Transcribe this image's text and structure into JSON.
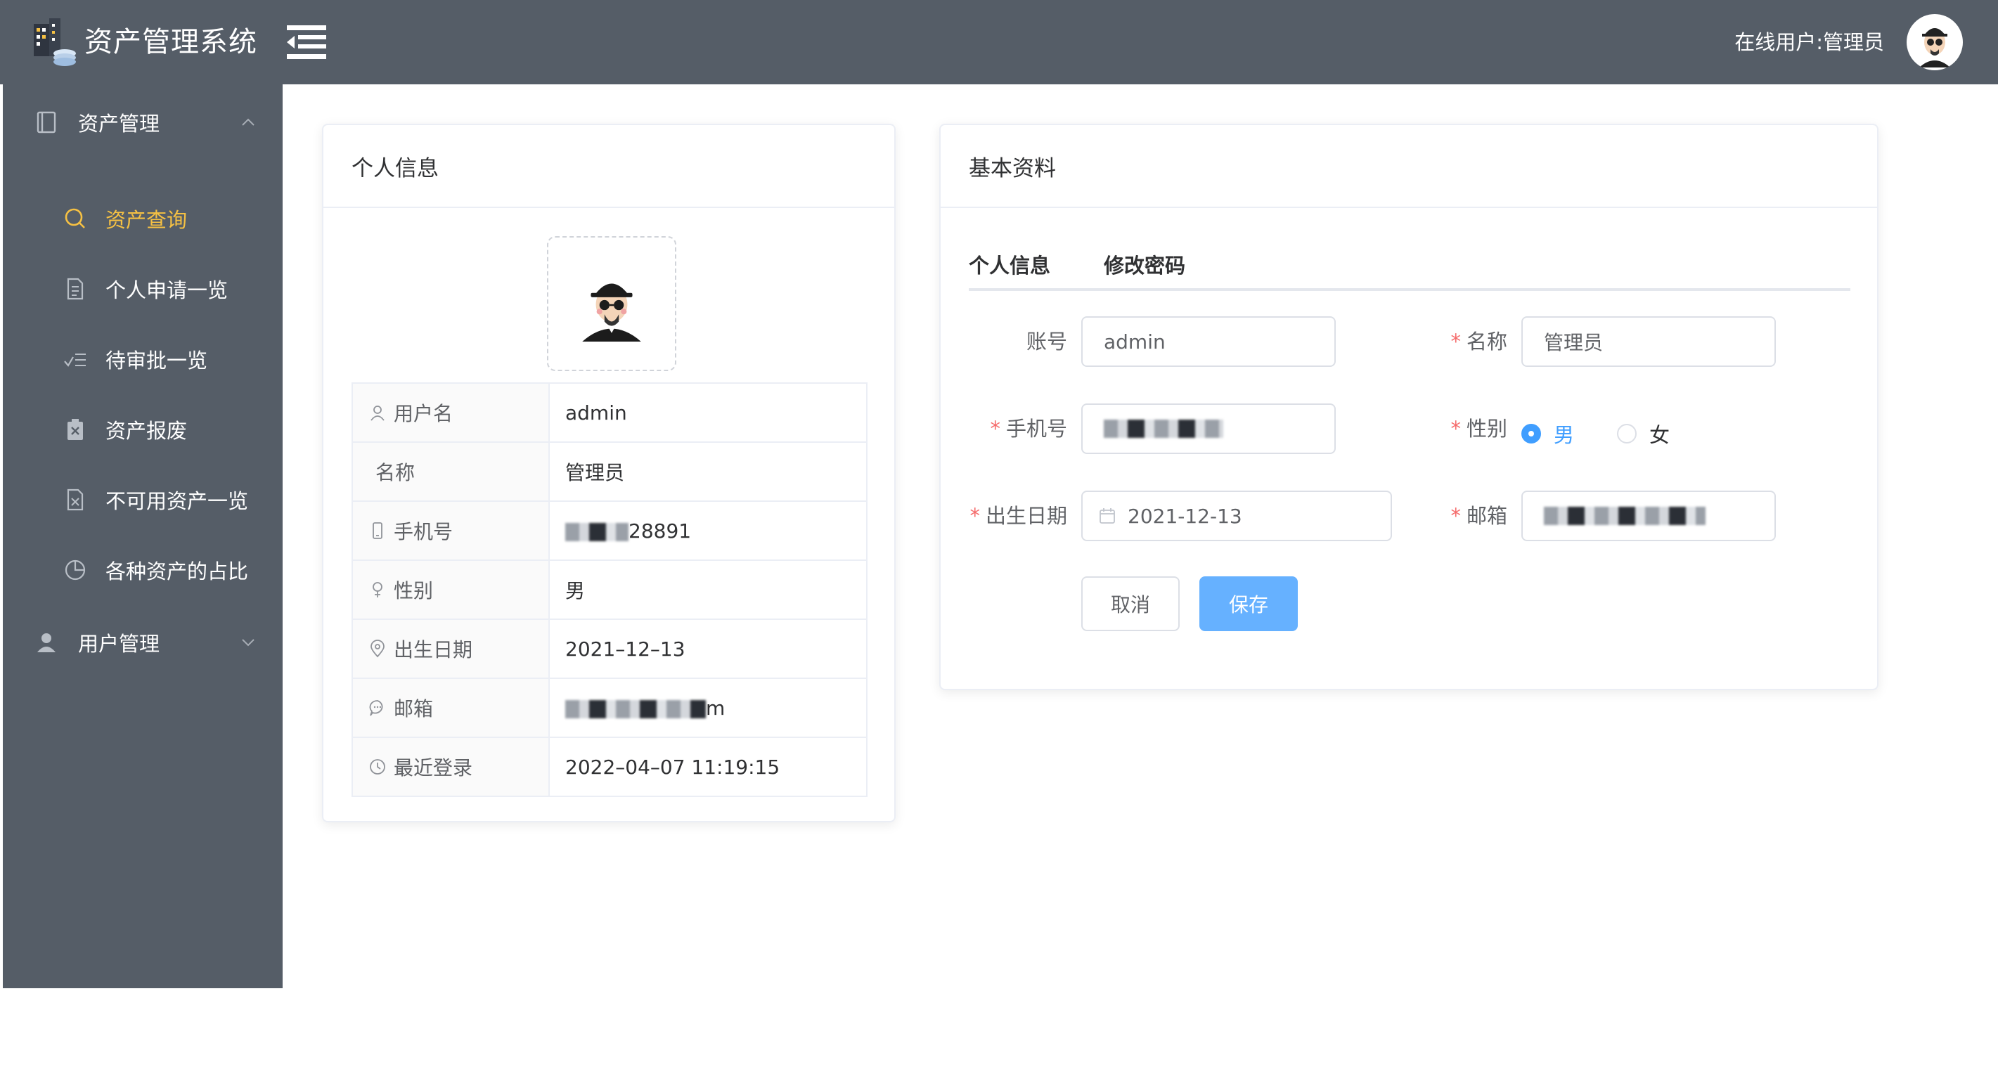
{
  "header": {
    "app_title": "资产管理系统",
    "online_user": "在线用户:管理员",
    "bg_color": "#555d67"
  },
  "sidebar": {
    "groups": [
      {
        "label": "资产管理",
        "icon": "book-icon",
        "expanded": true
      },
      {
        "label": "用户管理",
        "icon": "user-icon",
        "expanded": false
      }
    ],
    "items": [
      {
        "label": "资产查询",
        "icon": "search-icon",
        "active": true
      },
      {
        "label": "个人申请一览",
        "icon": "document-icon",
        "active": false
      },
      {
        "label": "待审批一览",
        "icon": "checklist-icon",
        "active": false
      },
      {
        "label": "资产报废",
        "icon": "discard-icon",
        "active": false
      },
      {
        "label": "不可用资产一览",
        "icon": "disabled-doc-icon",
        "active": false
      },
      {
        "label": "各种资产的占比",
        "icon": "pie-chart-icon",
        "active": false
      }
    ],
    "active_color": "#f6c143"
  },
  "profile_card": {
    "title": "个人信息",
    "rows": [
      {
        "label": "用户名",
        "icon": "user-outline-icon",
        "value": "admin"
      },
      {
        "label": "名称",
        "icon": "",
        "value": "管理员"
      },
      {
        "label": "手机号",
        "icon": "phone-icon",
        "value": "",
        "value_suffix": "28891"
      },
      {
        "label": "性别",
        "icon": "gender-icon",
        "value": "男"
      },
      {
        "label": "出生日期",
        "icon": "location-icon",
        "value": "2021–12–13"
      },
      {
        "label": "邮箱",
        "icon": "chat-icon",
        "value": "",
        "value_suffix": "m"
      },
      {
        "label": "最近登录",
        "icon": "clock-icon",
        "value": "2022–04–07 11:19:15"
      }
    ]
  },
  "basic_card": {
    "title": "基本资料",
    "tabs": [
      "个人信息",
      "修改密码"
    ],
    "form": {
      "account_label": "账号",
      "account_value": "admin",
      "name_label": "名称",
      "name_value": "管理员",
      "phone_label": "手机号",
      "gender_label": "性别",
      "gender_options": [
        "男",
        "女"
      ],
      "gender_selected": "男",
      "birth_label": "出生日期",
      "birth_value": "2021-12-13",
      "email_label": "邮箱"
    },
    "buttons": {
      "cancel": "取消",
      "save": "保存"
    },
    "required_color": "#f56c6c",
    "primary_color": "#409eff"
  }
}
